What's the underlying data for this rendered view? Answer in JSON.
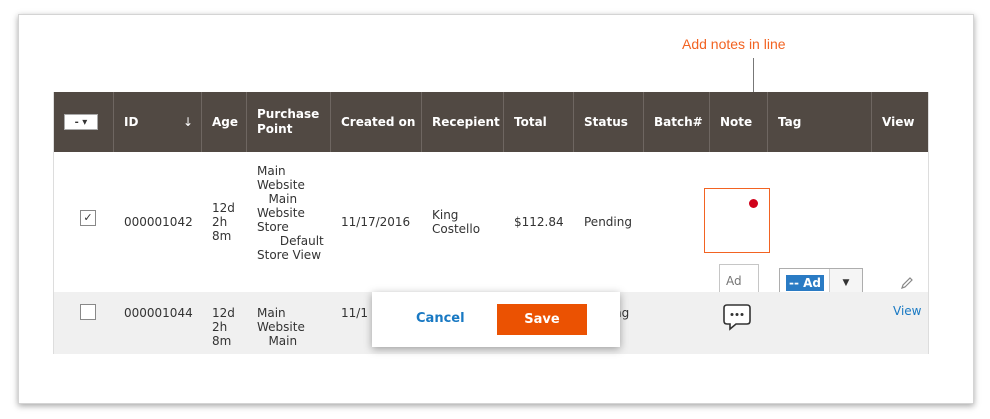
{
  "annotation": {
    "text": "Add notes in line"
  },
  "columns": [
    {
      "id": "select",
      "label": "- ▾"
    },
    {
      "id": "id",
      "label": "ID"
    },
    {
      "id": "age",
      "label": "Age"
    },
    {
      "id": "purchase_point",
      "label": "Purchase Point"
    },
    {
      "id": "created_on",
      "label": "Created on"
    },
    {
      "id": "recipient",
      "label": "Recepient"
    },
    {
      "id": "total",
      "label": "Total"
    },
    {
      "id": "status",
      "label": "Status"
    },
    {
      "id": "batch",
      "label": "Batch#"
    },
    {
      "id": "note",
      "label": "Note"
    },
    {
      "id": "tag",
      "label": "Tag"
    },
    {
      "id": "view",
      "label": "View"
    }
  ],
  "sort_indicator": "↓",
  "rows": [
    {
      "checked": true,
      "check_glyph": "✓",
      "id": "000001042",
      "age": "12d\n2h\n8m",
      "purchase_point": "Main\nWebsite\n   Main\nWebsite\nStore\n      Default\nStore View",
      "created_on": "11/17/2016",
      "recipient": "King\nCostello",
      "total": "$112.84",
      "status": "Pending",
      "note_placeholder": "Ad",
      "tag_value": "-- Ad",
      "tag_arrow": "▼"
    },
    {
      "checked": false,
      "id": "000001044",
      "age": "12d\n2h\n8m",
      "purchase_point": "Main\nWebsite\n   Main",
      "created_on": "11/1",
      "status_fragment": "ng",
      "view_label": "View"
    }
  ],
  "popup": {
    "cancel_label": "Cancel",
    "save_label": "Save"
  },
  "icons": {
    "edit": "pencil-icon",
    "note": "chat-bubble-icon"
  },
  "colors": {
    "header_bg": "#514943",
    "accent": "#f26322",
    "save_bg": "#eb5202",
    "link": "#1979c3",
    "tag_highlight": "#2a7bc4"
  }
}
